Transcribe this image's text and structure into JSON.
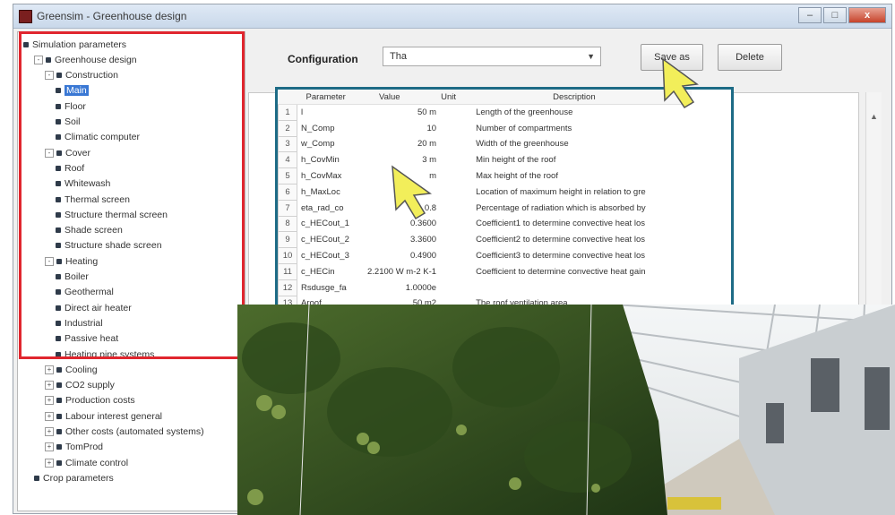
{
  "window": {
    "title": "Greensim - Greenhouse design",
    "buttons": [
      "–",
      "□",
      "x"
    ]
  },
  "tree": {
    "nodes": [
      {
        "label": "Simulation parameters"
      },
      {
        "label": "Greenhouse design"
      },
      {
        "label": "Construction"
      },
      {
        "label": "Main"
      },
      {
        "label": "Floor"
      },
      {
        "label": "Soil"
      },
      {
        "label": "Climatic computer"
      },
      {
        "label": "Cover"
      },
      {
        "label": "Roof"
      },
      {
        "label": "Whitewash"
      },
      {
        "label": "Thermal screen"
      },
      {
        "label": "Structure thermal screen"
      },
      {
        "label": "Shade screen"
      },
      {
        "label": "Structure shade screen"
      },
      {
        "label": "Heating"
      },
      {
        "label": "Boiler"
      },
      {
        "label": "Geothermal"
      },
      {
        "label": "Direct air heater"
      },
      {
        "label": "Industrial"
      },
      {
        "label": "Passive heat"
      },
      {
        "label": "Heating pipe systems"
      },
      {
        "label": "Cooling"
      },
      {
        "label": "CO2 supply"
      },
      {
        "label": "Production costs"
      },
      {
        "label": "Labour interest general"
      },
      {
        "label": "Other costs (automated systems)"
      },
      {
        "label": "TomProd"
      },
      {
        "label": "Climate control"
      },
      {
        "label": "Crop parameters"
      }
    ]
  },
  "config": {
    "label": "Configuration",
    "value": "Tha",
    "save_as_label": "Save as",
    "delete_label": "Delete"
  },
  "table": {
    "headers": {
      "parameter": "Parameter",
      "value": "Value",
      "unit": "Unit",
      "description": "Description"
    },
    "rows": [
      {
        "n": "1",
        "param": "l",
        "value": "50 m",
        "desc": "Length of the greenhouse"
      },
      {
        "n": "2",
        "param": "N_Comp",
        "value": "10",
        "desc": "Number of compartments"
      },
      {
        "n": "3",
        "param": "w_Comp",
        "value": "20 m",
        "desc": "Width of the greenhouse"
      },
      {
        "n": "4",
        "param": "h_CovMin",
        "value": "3 m",
        "desc": "Min height of the roof"
      },
      {
        "n": "5",
        "param": "h_CovMax",
        "value": "m",
        "desc": "Max height of the roof"
      },
      {
        "n": "6",
        "param": "h_MaxLoc",
        "value": "",
        "desc": "Location of maximum height in relation to gre"
      },
      {
        "n": "7",
        "param": "eta_rad_co",
        "value": "0.8",
        "desc": "Percentage of radiation which is absorbed by"
      },
      {
        "n": "8",
        "param": "c_HECout_1",
        "value": "0.3600",
        "desc": "Coefficient1 to determine convective heat los"
      },
      {
        "n": "9",
        "param": "c_HECout_2",
        "value": "3.3600",
        "desc": "Coefficient2 to determine convective heat los"
      },
      {
        "n": "10",
        "param": "c_HECout_3",
        "value": "0.4900",
        "desc": "Coefficient3 to determine convective heat los"
      },
      {
        "n": "11",
        "param": "c_HECin",
        "value": "2.2100 W m-2 K-1",
        "desc": "Coefficient to determine convective heat gain"
      },
      {
        "n": "12",
        "param": "Rsdusge_fa",
        "value": "1.0000e",
        "desc": ""
      },
      {
        "n": "13",
        "param": "Aroof",
        "value": "50 m2",
        "desc": "The roof ventilation area"
      }
    ]
  },
  "colors": {
    "highlight_red": "#e0262e",
    "frame_teal": "#1d6b86",
    "cursor_yellow": "#f2ee5a"
  },
  "photo": {
    "alt": "greenhouse tomato crop photograph"
  }
}
